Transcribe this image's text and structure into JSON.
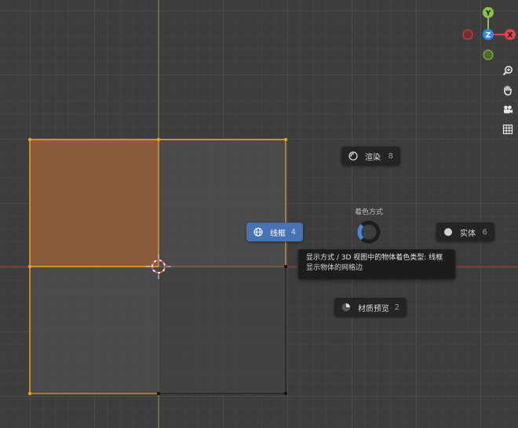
{
  "pie_menu": {
    "title": "着色方式",
    "items": [
      {
        "id": "render",
        "label": "渲染",
        "key": "8",
        "icon": "render-icon"
      },
      {
        "id": "wireframe",
        "label": "线框",
        "key": "4",
        "icon": "wireframe-icon",
        "active": true
      },
      {
        "id": "solid",
        "label": "实体",
        "key": "6",
        "icon": "solid-icon"
      },
      {
        "id": "material",
        "label": "材质预览",
        "key": "2",
        "icon": "material-preview-icon"
      }
    ]
  },
  "tooltip": {
    "line1": "显示方式 / 3D 视图中的物体着色类型: 线框",
    "line2": "显示物体的网格边"
  },
  "gizmo": {
    "axes": {
      "y": "Y",
      "z": "Z",
      "x": "X"
    },
    "colors": {
      "x": "#e0424f",
      "y": "#8bc34a",
      "z": "#2f8ae8"
    }
  },
  "navigation": [
    "zoom-icon",
    "pan-hand-icon",
    "camera-icon",
    "grid-view-icon"
  ],
  "colors": {
    "accent": "#4772b3",
    "selection": "#f5a623",
    "selected_face": "#8a5a3b"
  }
}
